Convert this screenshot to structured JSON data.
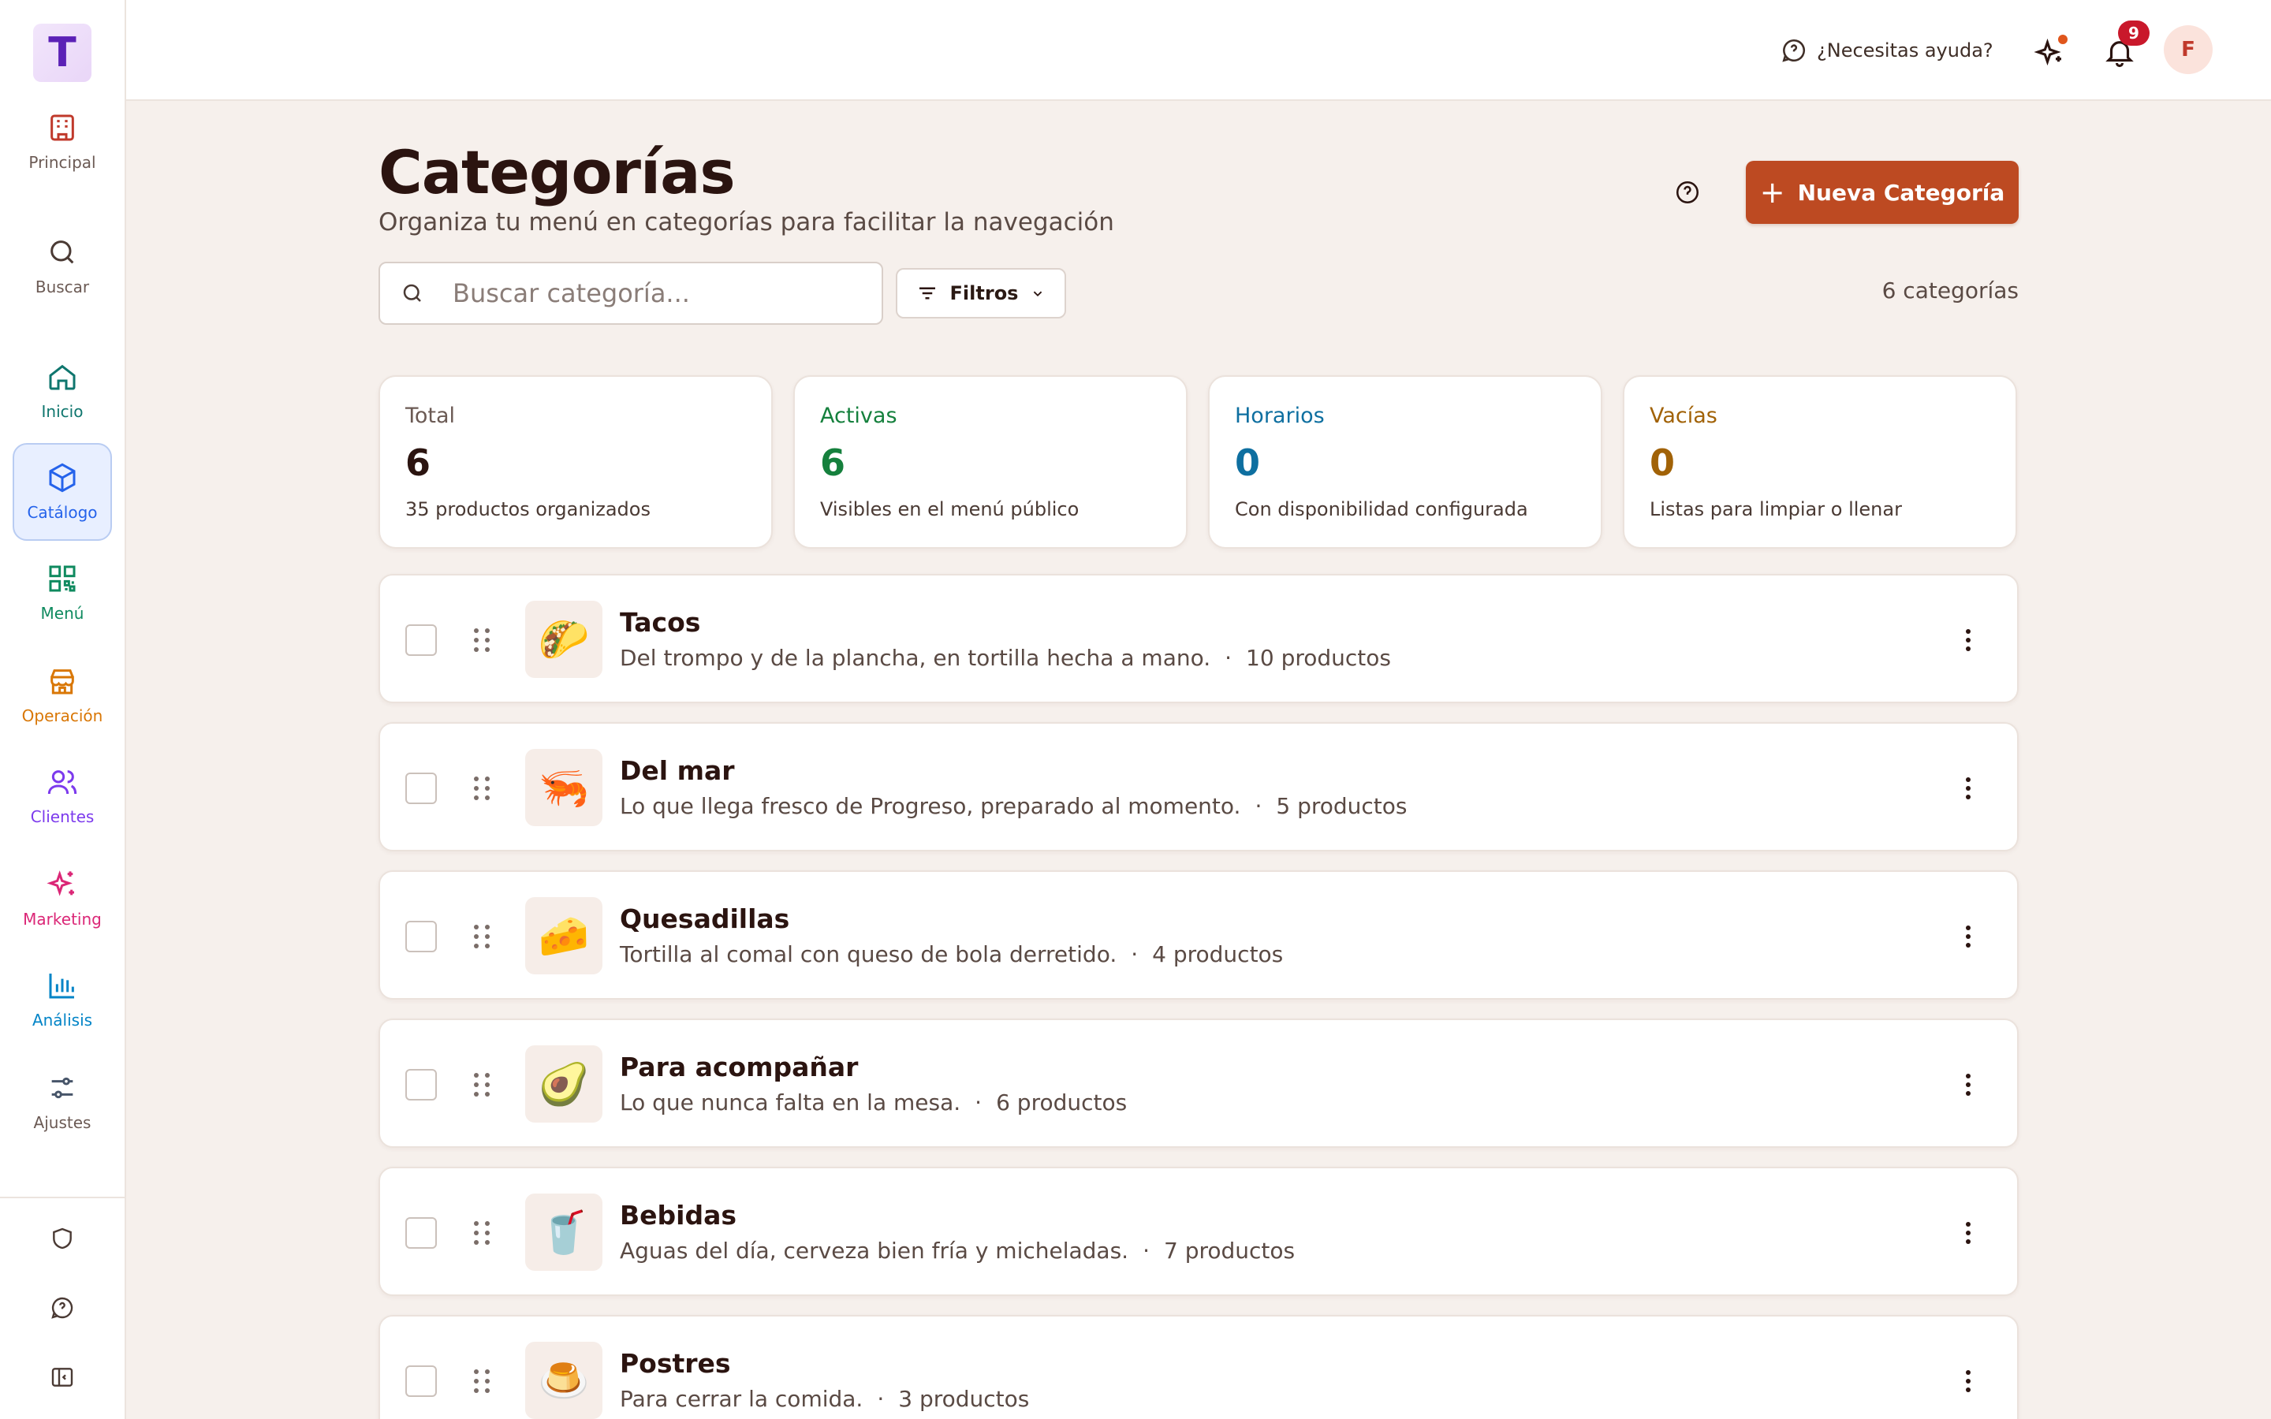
{
  "app": {
    "logo_letter": "T"
  },
  "sidebar": {
    "items": [
      {
        "label": "Principal",
        "color": "#c0392b"
      },
      {
        "label": "Buscar",
        "color": "#4a3a34"
      },
      {
        "label": "Inicio",
        "color": "#0f766e"
      },
      {
        "label": "Catálogo",
        "color": "#2563eb",
        "active": true
      },
      {
        "label": "Menú",
        "color": "#0f8a5f"
      },
      {
        "label": "Operación",
        "color": "#d97706"
      },
      {
        "label": "Clientes",
        "color": "#7c3aed"
      },
      {
        "label": "Marketing",
        "color": "#db2777"
      },
      {
        "label": "Análisis",
        "color": "#0284c7"
      },
      {
        "label": "Ajustes",
        "color": "#475569"
      }
    ]
  },
  "topbar": {
    "help_label": "¿Necesitas ayuda?",
    "notifications_count": "9",
    "avatar_initial": "F"
  },
  "header": {
    "title": "Categorías",
    "subtitle": "Organiza tu menú en categorías para facilitar la navegación",
    "new_button_label": "Nueva Categoría"
  },
  "toolbar": {
    "search_placeholder": "Buscar categoría...",
    "filters_label": "Filtros",
    "count_label": "6 categorías"
  },
  "stats": [
    {
      "label": "Total",
      "value": "6",
      "desc": "35 productos organizados",
      "color": "#6b5a54",
      "value_color": "#2b1410"
    },
    {
      "label": "Activas",
      "value": "6",
      "desc": "Visibles en el menú público",
      "color": "#15803d",
      "value_color": "#15803d"
    },
    {
      "label": "Horarios",
      "value": "0",
      "desc": "Con disponibilidad configurada",
      "color": "#0e6fa0",
      "value_color": "#0e6fa0"
    },
    {
      "label": "Vacías",
      "value": "0",
      "desc": "Listas para limpiar o llenar",
      "color": "#a16207",
      "value_color": "#a16207"
    }
  ],
  "categories": [
    {
      "name": "Tacos",
      "emoji": "🌮",
      "description": "Del trompo y de la plancha, en tortilla hecha a mano.",
      "sep": "·",
      "products": "10 productos"
    },
    {
      "name": "Del mar",
      "emoji": "🦐",
      "description": "Lo que llega fresco de Progreso, preparado al momento.",
      "sep": "·",
      "products": "5 productos"
    },
    {
      "name": "Quesadillas",
      "emoji": "🧀",
      "description": "Tortilla al comal con queso de bola derretido.",
      "sep": "·",
      "products": "4 productos"
    },
    {
      "name": "Para acompañar",
      "emoji": "🥑",
      "description": "Lo que nunca falta en la mesa.",
      "sep": "·",
      "products": "6 productos"
    },
    {
      "name": "Bebidas",
      "emoji": "🥤",
      "description": "Aguas del día, cerveza bien fría y micheladas.",
      "sep": "·",
      "products": "7 productos"
    },
    {
      "name": "Postres",
      "emoji": "🍮",
      "description": "Para cerrar la comida.",
      "sep": "·",
      "products": "3 productos"
    }
  ]
}
